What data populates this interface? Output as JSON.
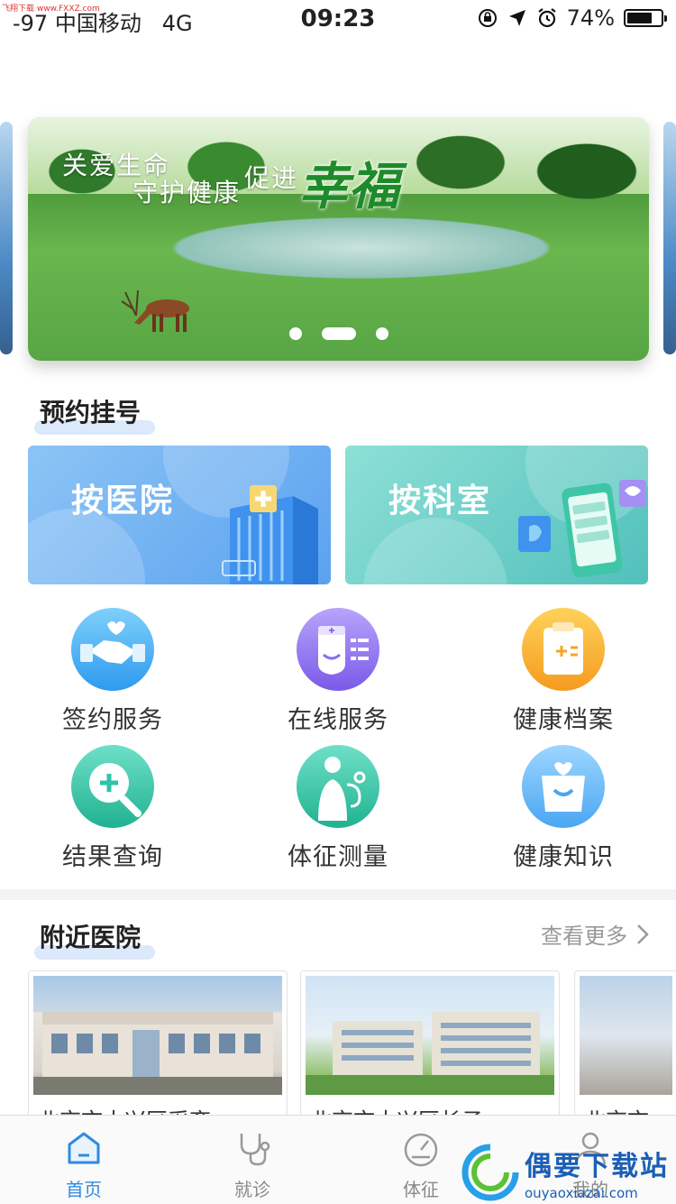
{
  "status_bar": {
    "carrier": "-97 中国移动",
    "network": "4G",
    "time": "09:23",
    "battery": "74%",
    "battery_level": 0.74
  },
  "top_watermark": "飞翔下载 www.FXXZ.com",
  "banner": {
    "slogan_line1": "关爱生命",
    "slogan_line2": "守护健康",
    "slogan_line3": "促进",
    "slogan_highlight": "幸福",
    "page_count": 3,
    "active_page": 2
  },
  "appointment": {
    "title": "预约挂号",
    "by_hospital": "按医院",
    "by_department": "按科室"
  },
  "services": [
    {
      "label": "签约服务",
      "icon": "handshake-icon",
      "color": "#3aa8f0"
    },
    {
      "label": "在线服务",
      "icon": "nurse-icon",
      "color": "#8b6cf0"
    },
    {
      "label": "健康档案",
      "icon": "clipboard-icon",
      "color": "#f5a623"
    },
    {
      "label": "结果查询",
      "icon": "search-plus-icon",
      "color": "#2fc3a8"
    },
    {
      "label": "体征测量",
      "icon": "stethoscope-icon",
      "color": "#2fc3a8"
    },
    {
      "label": "健康知识",
      "icon": "shopping-bag-icon",
      "color": "#4aa6f2"
    }
  ],
  "nearby": {
    "title": "附近医院",
    "more": "查看更多",
    "hospitals": [
      {
        "caption": "北京市大兴区采育..."
      },
      {
        "caption": "北京市大兴区长子..."
      },
      {
        "caption": "北京市..."
      }
    ]
  },
  "tabbar": {
    "tabs": [
      {
        "label": "首页",
        "icon": "home-icon",
        "active": true
      },
      {
        "label": "就诊",
        "icon": "stethoscope-icon",
        "active": false
      },
      {
        "label": "体征",
        "icon": "gauge-icon",
        "active": false
      },
      {
        "label": "我的",
        "icon": "user-icon",
        "active": false
      }
    ]
  },
  "watermark": {
    "title": "偶要下载站",
    "url": "ouyaoxiazai.com"
  },
  "colors": {
    "accent": "#2f8be0",
    "section_highlight": "#dbe9fb"
  }
}
